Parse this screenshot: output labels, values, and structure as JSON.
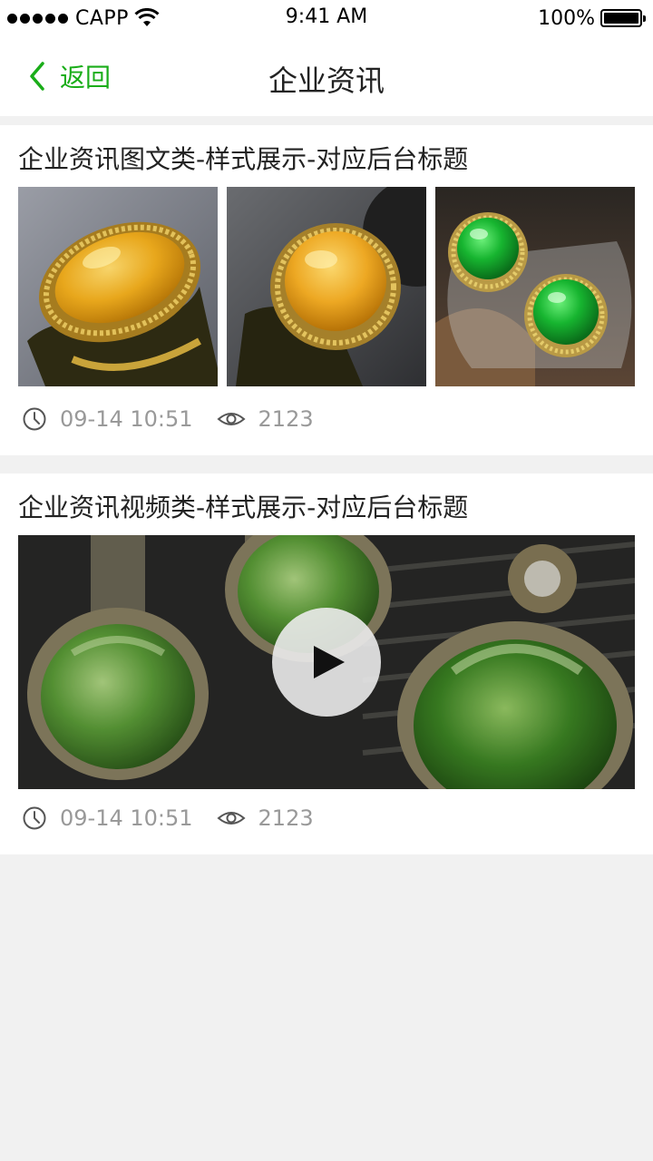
{
  "status_bar": {
    "carrier": "CAPP",
    "time": "9:41 AM",
    "battery": "100%"
  },
  "nav": {
    "back_label": "返回",
    "title": "企业资讯"
  },
  "articles": [
    {
      "title": "企业资讯图文类-样式展示-对应后台标题",
      "date": "09-14  10:51",
      "views": "2123"
    },
    {
      "title": "企业资讯视频类-样式展示-对应后台标题",
      "date": "09-14  10:51",
      "views": "2123"
    }
  ],
  "colors": {
    "accent": "#1aad19",
    "background": "#f1f1f1",
    "meta_text": "#999999"
  },
  "icons": [
    "chevron-left-icon",
    "clock-icon",
    "eye-icon",
    "play-icon",
    "wifi-icon"
  ]
}
